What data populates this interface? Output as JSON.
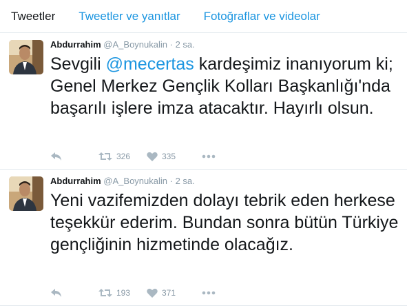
{
  "tabs": [
    {
      "label": "Tweetler"
    },
    {
      "label": "Tweetler ve yanıtlar"
    },
    {
      "label": "Fotoğraflar ve videolar"
    }
  ],
  "tweets": [
    {
      "name": "Abdurrahim",
      "handle": "@A_Boynukalin",
      "dot": "·",
      "time": "2 sa.",
      "text_before": "Sevgili ",
      "mention": "@mecertas",
      "text_after": " kardeşimiz inanıyorum ki; Genel Merkez Gençlik Kolları Başkanlığı'nda başarılı işlere imza atacaktır. Hayırlı olsun.",
      "retweets": "326",
      "likes": "335"
    },
    {
      "name": "Abdurrahim",
      "handle": "@A_Boynukalin",
      "dot": "·",
      "time": "2 sa.",
      "text": "Yeni vazifemizden dolayı tebrik eden herkese teşekkür ederim. Bundan sonra bütün Türkiye gençliğinin hizmetinde olacağız.",
      "retweets": "193",
      "likes": "371"
    }
  ],
  "icons": {
    "reply": "reply-icon",
    "retweet": "retweet-icon",
    "like": "heart-icon",
    "more": "more-icon"
  },
  "colors": {
    "link": "#1b95e0",
    "muted": "#8899a6",
    "border": "#e1e8ed"
  }
}
